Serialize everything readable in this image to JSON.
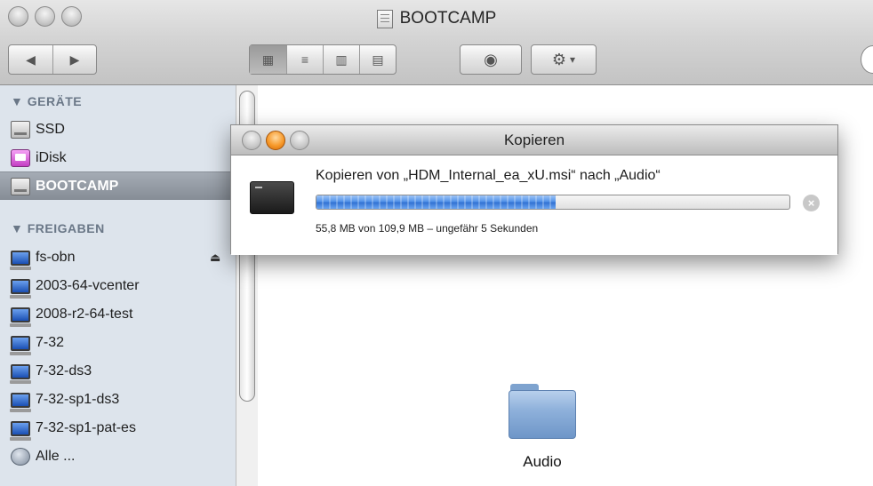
{
  "window": {
    "title": "BOOTCAMP",
    "icon": "document-icon"
  },
  "toolbar": {
    "back_icon": "◀",
    "forward_icon": "▶",
    "views": [
      {
        "name": "icon-view",
        "glyph": "▦",
        "active": true
      },
      {
        "name": "list-view",
        "glyph": "≡",
        "active": false
      },
      {
        "name": "column-view",
        "glyph": "▥",
        "active": false
      },
      {
        "name": "coverflow-view",
        "glyph": "▤",
        "active": false
      }
    ],
    "quicklook_glyph": "◉",
    "action_glyph": "⚙",
    "action_arrow": "▾"
  },
  "sidebar": {
    "devices_header": "▼ GERÄTE",
    "devices": [
      {
        "label": "SSD",
        "icon": "disk-icon",
        "selected": false
      },
      {
        "label": "iDisk",
        "icon": "idisk-icon",
        "selected": false
      },
      {
        "label": "BOOTCAMP",
        "icon": "disk-icon",
        "selected": true
      }
    ],
    "shares_header": "▼ FREIGABEN",
    "shares": [
      {
        "label": "fs-obn",
        "eject": true
      },
      {
        "label": "2003-64-vcenter"
      },
      {
        "label": "2008-r2-64-test"
      },
      {
        "label": "7-32"
      },
      {
        "label": "7-32-ds3"
      },
      {
        "label": "7-32-sp1-ds3"
      },
      {
        "label": "7-32-sp1-pat-es"
      }
    ],
    "all_label": "Alle ...",
    "eject_glyph": "⏏"
  },
  "main": {
    "folder_label": "Audio"
  },
  "dialog": {
    "title": "Kopieren",
    "message": "Kopieren von „HDM_Internal_ea_xU.msi“ nach „Audio“",
    "progress": 0.505,
    "status": "55,8 MB von 109,9 MB – ungefähr 5 Sekunden",
    "stop_glyph": "×"
  },
  "colors": {
    "sidebar_bg": "#dde4ec",
    "selection": "#868d96",
    "progress_blue": "#4b8de6",
    "close_orange": "#f79a2b"
  }
}
